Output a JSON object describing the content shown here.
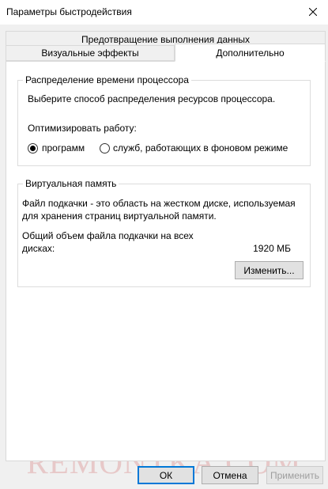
{
  "window": {
    "title": "Параметры быстродействия"
  },
  "tabs": {
    "row1": [
      "Предотвращение выполнения данных"
    ],
    "row2": [
      "Визуальные эффекты",
      "Дополнительно"
    ],
    "active": "Дополнительно"
  },
  "processor": {
    "group_title": "Распределение времени процессора",
    "description": "Выберите способ распределения ресурсов процессора.",
    "optimize_label": "Оптимизировать работу:",
    "options": [
      {
        "label": "программ",
        "selected": true
      },
      {
        "label": "служб, работающих в фоновом режиме",
        "selected": false
      }
    ]
  },
  "virtual_memory": {
    "group_title": "Виртуальная память",
    "description_line1": "Файл подкачки - это область на жестком диске, используемая",
    "description_line2": "для хранения страниц виртуальной памяти.",
    "total_label_line1": "Общий объем файла подкачки на всех",
    "total_label_line2": "дисках:",
    "total_value": "1920 МБ",
    "change_button": "Изменить..."
  },
  "footer": {
    "ok": "ОК",
    "cancel": "Отмена",
    "apply": "Применить"
  },
  "watermark": "REMONTKA.COM",
  "colors": {
    "accent": "#0078d7",
    "watermark": "#c83c3c"
  }
}
